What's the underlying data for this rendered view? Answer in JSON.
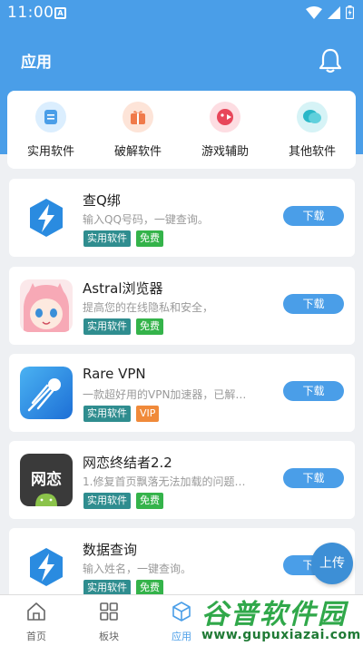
{
  "status": {
    "time": "11:00",
    "a_icon_letter": "A"
  },
  "header": {
    "title": "应用"
  },
  "categories": [
    {
      "label": "实用软件",
      "icon": "document-icon",
      "color": "#4a9ee8"
    },
    {
      "label": "破解软件",
      "icon": "gift-icon",
      "color": "#f07a4a"
    },
    {
      "label": "游戏辅助",
      "icon": "game-icon",
      "color": "#e8465a"
    },
    {
      "label": "其他软件",
      "icon": "chat-icon",
      "color": "#2ab8c8"
    }
  ],
  "apps": [
    {
      "name": "查Q绑",
      "desc": "输入QQ号码，一键查询。",
      "tags": [
        "实用软件",
        "免费"
      ],
      "button": "下载",
      "icon": "bolt-icon"
    },
    {
      "name": "Astral浏览器",
      "desc": "提高您的在线隐私和安全，",
      "tags": [
        "实用软件",
        "免费"
      ],
      "button": "下载",
      "icon": "anime-avatar-icon"
    },
    {
      "name": "Rare VPN",
      "desc": "一款超好用的VPN加速器，已解…",
      "tags": [
        "实用软件",
        "VIP"
      ],
      "button": "下载",
      "icon": "comet-icon"
    },
    {
      "name": "网恋终结者2.2",
      "desc": "1.修复首页飘落无法加载的问题…",
      "tags": [
        "实用软件",
        "免费"
      ],
      "button": "下载",
      "icon": "android-icon",
      "icon_text": "网恋"
    },
    {
      "name": "数据查询",
      "desc": "输入姓名，一键查询。",
      "tags": [
        "实用软件",
        "免费"
      ],
      "button": "下载",
      "icon": "bolt-icon"
    }
  ],
  "upload_button": "上传",
  "nav": [
    {
      "label": "首页",
      "icon": "home-icon"
    },
    {
      "label": "板块",
      "icon": "grid-icon"
    },
    {
      "label": "应用",
      "icon": "cube-icon",
      "active": true
    }
  ],
  "watermark": {
    "title": "谷普软件园",
    "url": "www.gupuxiazai.com"
  }
}
